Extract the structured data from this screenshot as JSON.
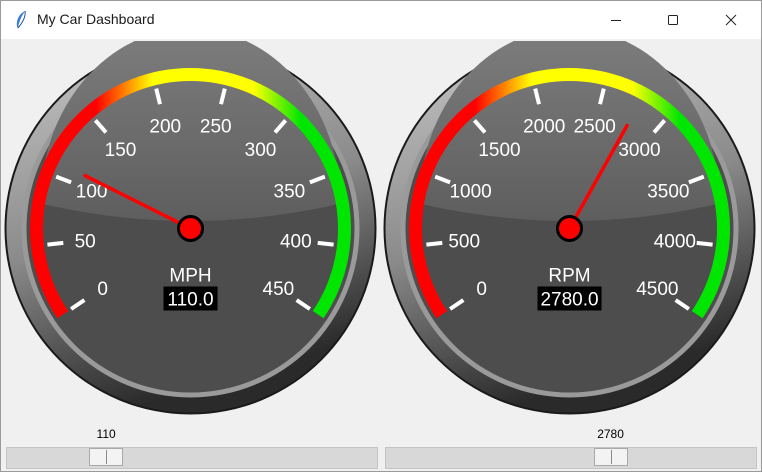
{
  "window": {
    "title": "My Car Dashboard",
    "icon": "feather-icon",
    "controls": [
      "minimize-icon",
      "maximize-icon",
      "close-icon"
    ]
  },
  "colors": {
    "zone_red": "#ff0000",
    "zone_yellow": "#ffff00",
    "zone_green": "#00e600",
    "needle": "#ff0000",
    "face": "#4d4d4d",
    "bezel": "#a0a0a0"
  },
  "gauges": [
    {
      "label": "MPH",
      "readout": "110.0",
      "value": 110,
      "min": 0,
      "max": 450,
      "ticks": [
        "0",
        "50",
        "100",
        "150",
        "200",
        "250",
        "300",
        "350",
        "400",
        "450"
      ]
    },
    {
      "label": "RPM",
      "readout": "2780.0",
      "value": 2780,
      "min": 0,
      "max": 4500,
      "ticks": [
        "0",
        "500",
        "1000",
        "1500",
        "2000",
        "2500",
        "3000",
        "3500",
        "4000",
        "4500"
      ]
    }
  ],
  "sliders": [
    {
      "value": "110",
      "min": 0,
      "max": 450
    },
    {
      "value": "2780",
      "min": 0,
      "max": 4500
    }
  ]
}
